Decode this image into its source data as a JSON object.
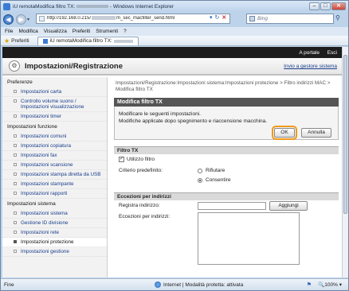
{
  "window": {
    "title": "iU remotaModifica filtro TX:",
    "title_suffix": "- Windows Internet Explorer"
  },
  "address": {
    "url_prefix": "http://192.168.0.215/",
    "url_suffix": "m_sec_macfilter_send.html",
    "search_placeholder": "Bing"
  },
  "menu": [
    "File",
    "Modifica",
    "Visualizza",
    "Preferiti",
    "Strumenti",
    "?"
  ],
  "favorites": {
    "label": "Preferiti",
    "tab_label": "iU remotaModifica filtro TX:"
  },
  "topstrip": {
    "portal": "A portale",
    "logout": "Esci"
  },
  "header": {
    "title": "Impostazioni/Registrazione",
    "link": "Invio a gestore sistema"
  },
  "sidebar": {
    "sections": [
      {
        "title": "Preferenze",
        "items": [
          "Impostazioni carta",
          "Controllo volume suono / Impostazioni visualizzazione",
          "Impostazioni timer"
        ]
      },
      {
        "title": "Impostazioni funzione",
        "items": [
          "Impostazioni comuni",
          "Impostazioni copiatura",
          "Impostazioni fax",
          "Impostazioni scansione",
          "Impostazioni stampa diretta da USB",
          "Impostazioni stampante",
          "Impostazioni rapporti"
        ]
      },
      {
        "title": "Impostazioni sistema",
        "items": [
          "Impostazioni sistema",
          "Gestione ID divisione",
          "Impostazioni rete",
          "Impostazioni protezione",
          "Impostazioni gestione"
        ]
      }
    ],
    "active": "Impostazioni protezione"
  },
  "main": {
    "breadcrumb": "Impostazioni/Registrazione:Impostazioni sistema:Impostazioni protezione > Filtro indirizzi MAC > Modifica filtro TX",
    "dialog_title": "Modifica filtro TX",
    "dialog_msg1": "Modificare le seguenti impostazioni.",
    "dialog_msg2": "Modifiche applicate dopo spegnimento e riaccensione macchina.",
    "ok_label": "OK",
    "cancel_label": "Annulla",
    "filter_section": "Filtro TX",
    "use_filter_label": "Utilizzo filtro",
    "use_filter_checked": true,
    "default_policy_label": "Criterio predefinito:",
    "policy_reject": "Rifiutare",
    "policy_allow": "Consentire",
    "policy_selected": "Consentire",
    "exceptions_section": "Eccezioni per indirizzi",
    "register_address_label": "Registra indirizzo:",
    "add_label": "Aggiungi",
    "exceptions_list_label": "Eccezioni per indirizzi:"
  },
  "status": {
    "left": "Fine",
    "zone": "Internet | Modalità protetta: attivata",
    "zoom": "100%"
  },
  "colors": {
    "accent": "#f09a1a",
    "topstrip": "#1d1d1d",
    "link": "#1a3e8c"
  }
}
